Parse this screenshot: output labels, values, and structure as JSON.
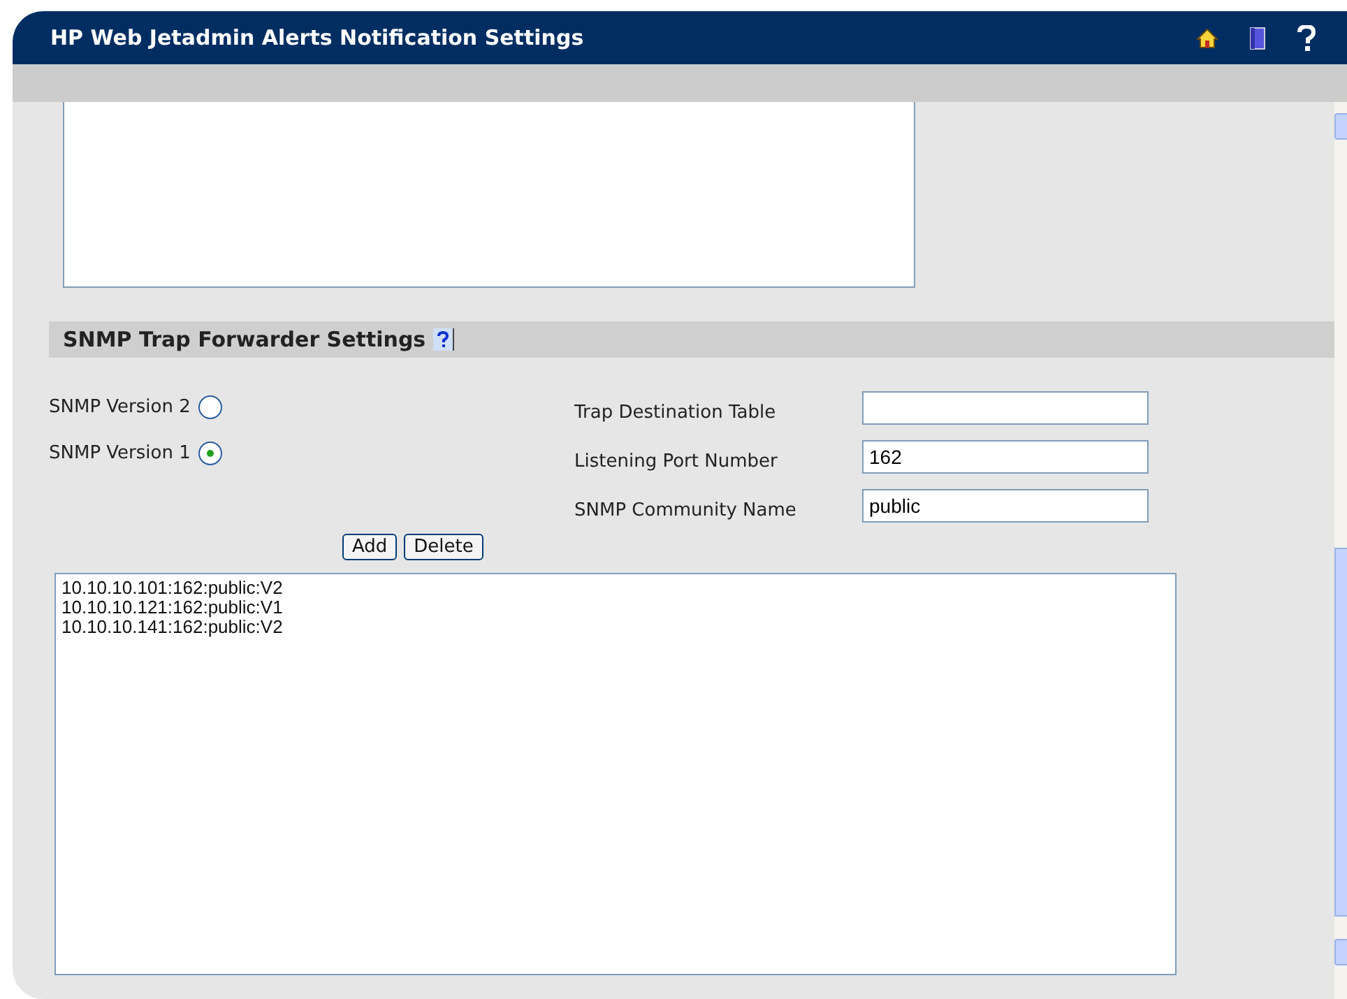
{
  "window": {
    "title": "HP Web Jetadmin Alerts Notification Settings"
  },
  "section": {
    "title": "SNMP Trap Forwarder Settings"
  },
  "versions": [
    {
      "label": "SNMP Version 2",
      "selected": false
    },
    {
      "label": "SNMP Version 1",
      "selected": true
    }
  ],
  "fields": [
    {
      "label": "Trap Destination Table"
    },
    {
      "label": "Listening Port Number",
      "value": "162"
    },
    {
      "label": "SNMP Community Name",
      "value": "public"
    }
  ],
  "buttons": [
    "Add",
    "Delete"
  ],
  "destinations": [
    "10.10.10.101:162:public:V2",
    "10.10.10.121:162:public:V1",
    "10.10.10.141:162:public:V2"
  ]
}
